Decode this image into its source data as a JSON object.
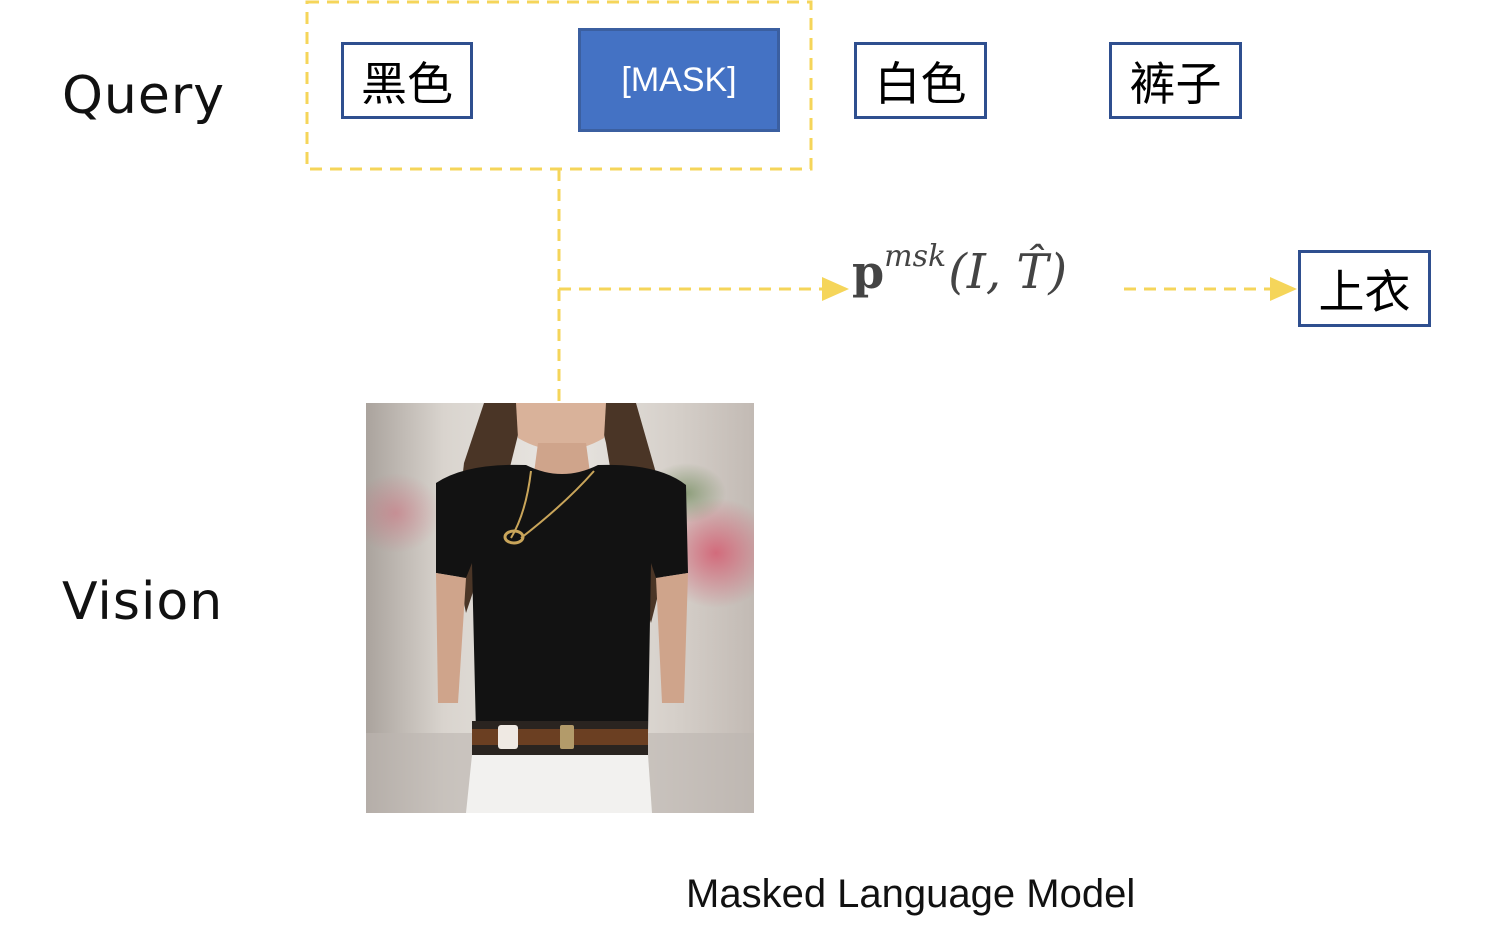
{
  "labels": {
    "query": "Query",
    "vision": "Vision"
  },
  "tokens": [
    {
      "text": "黑色"
    },
    {
      "text": "[MASK]"
    },
    {
      "text": "白色"
    },
    {
      "text": "裤子"
    }
  ],
  "formula": {
    "base": "p",
    "superscript": "msk",
    "args": "(I, T̂)"
  },
  "output_token": "上衣",
  "caption": "Masked Language Model",
  "colors": {
    "mask_fill": "#4472c4",
    "token_border": "#2f4f8f",
    "dashed_line": "#f5d55a"
  }
}
